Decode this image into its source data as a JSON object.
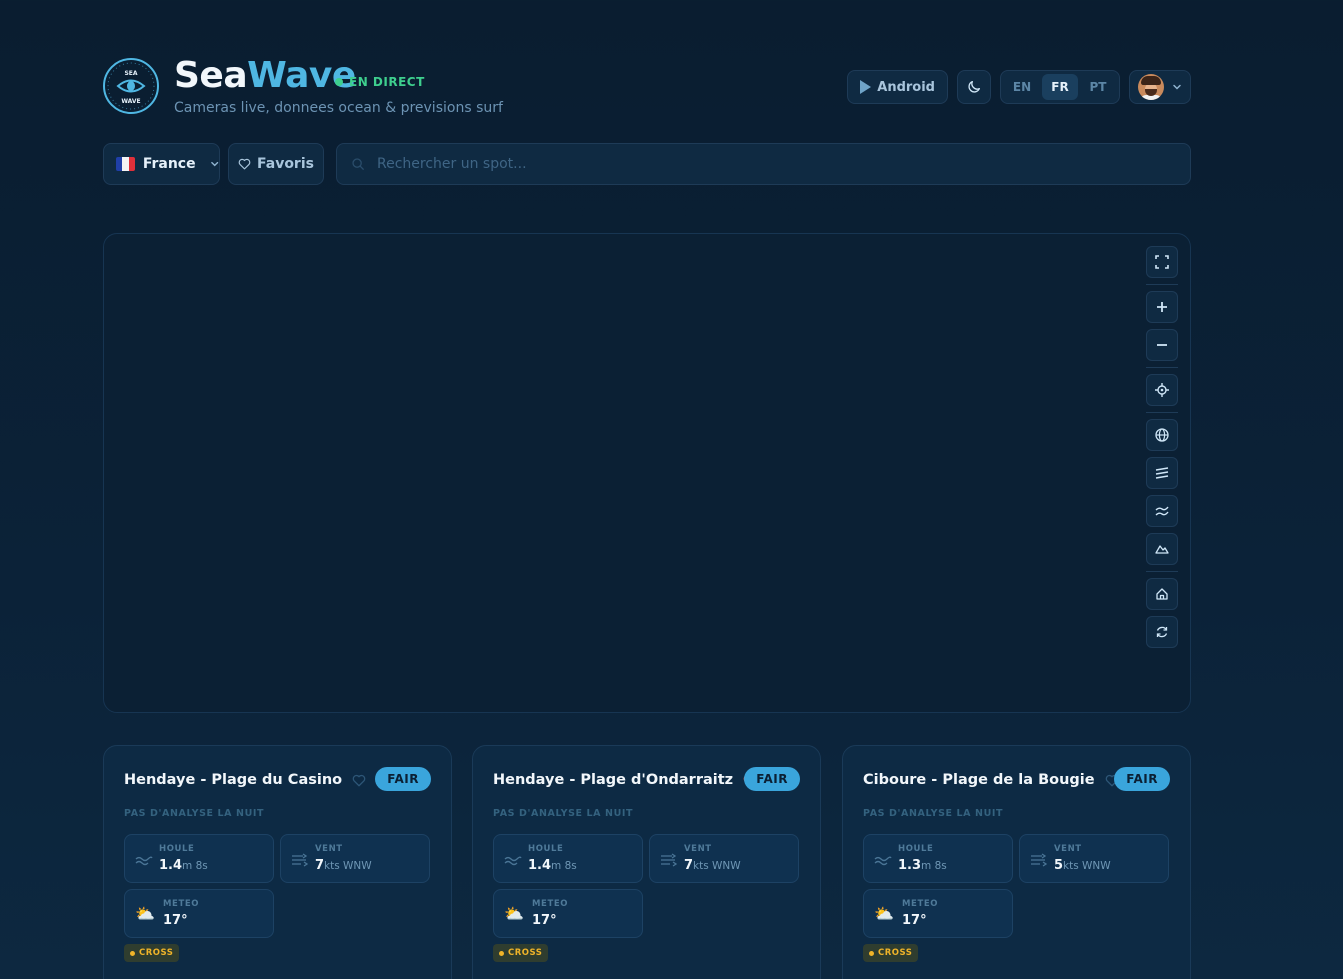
{
  "brand": {
    "name_part1": "Sea",
    "name_part2": "Wave",
    "logo_top": "SEA",
    "logo_bottom": "WAVE",
    "live_label": "EN DIRECT",
    "tagline": "Cameras live, donnees ocean & previsions surf"
  },
  "header": {
    "android_label": "Android",
    "theme_icon": "moon-icon",
    "languages": [
      "EN",
      "FR",
      "PT"
    ],
    "active_language": "FR"
  },
  "toolbar": {
    "country_label": "France",
    "favorites_label": "Favoris",
    "search_placeholder": "Rechercher un spot..."
  },
  "map": {
    "controls": [
      "fullscreen-icon",
      "zoom-in-icon",
      "zoom-out-icon",
      "locate-icon",
      "globe-icon",
      "swell-layer-icon",
      "wave-layer-icon",
      "terrain-icon",
      "home-icon",
      "refresh-icon"
    ]
  },
  "cards": [
    {
      "title": "Hendaye - Plage du Casino",
      "favorite": false,
      "rating": "FAIR",
      "note": "PAS D'ANALYSE LA NUIT",
      "swell_label": "HOULE",
      "swell_value": "1.4",
      "swell_unit": "m 8s",
      "wind_label": "VENT",
      "wind_value": "7",
      "wind_unit": "kts WNW",
      "weather_label": "METEO",
      "weather_value": "17°",
      "weather_icon": "⛅",
      "wind_type": "CROSS"
    },
    {
      "title": "Hendaye - Plage d'Ondarraitz",
      "favorite": true,
      "rating": "FAIR",
      "note": "PAS D'ANALYSE LA NUIT",
      "swell_label": "HOULE",
      "swell_value": "1.4",
      "swell_unit": "m 8s",
      "wind_label": "VENT",
      "wind_value": "7",
      "wind_unit": "kts WNW",
      "weather_label": "METEO",
      "weather_value": "17°",
      "weather_icon": "⛅",
      "wind_type": "CROSS"
    },
    {
      "title": "Ciboure - Plage de la Bougie",
      "favorite": false,
      "rating": "FAIR",
      "note": "PAS D'ANALYSE LA NUIT",
      "swell_label": "HOULE",
      "swell_value": "1.3",
      "swell_unit": "m 8s",
      "wind_label": "VENT",
      "wind_value": "5",
      "wind_unit": "kts WNW",
      "weather_label": "METEO",
      "weather_value": "17°",
      "weather_icon": "⛅",
      "wind_type": "CROSS"
    }
  ],
  "colors": {
    "accent": "#4fb7e3",
    "live": "#3ecf8e",
    "badge": "#3aa5dc",
    "favorite": "#ff6b5e",
    "cross": "#f0b429"
  }
}
